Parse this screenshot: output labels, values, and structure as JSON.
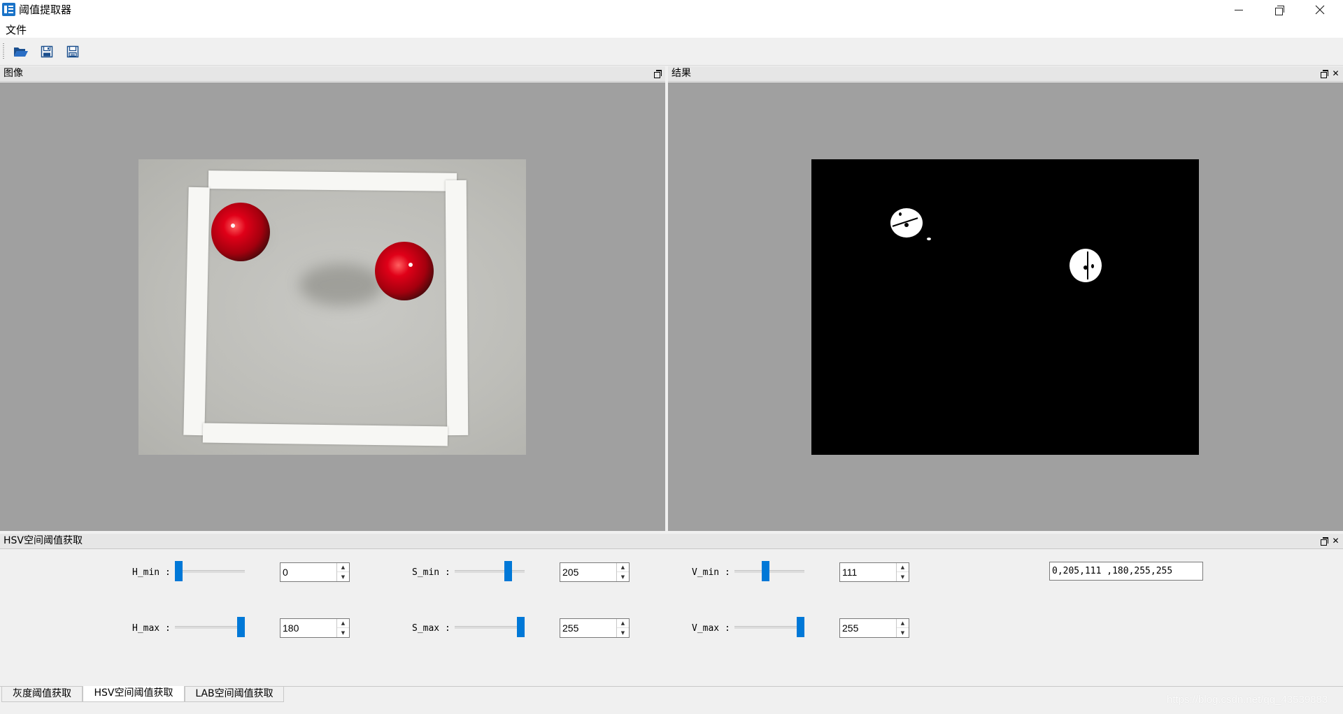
{
  "window": {
    "title": "阈值提取器",
    "controls": [
      "minimize",
      "restore",
      "close"
    ]
  },
  "menu": {
    "items": [
      "文件"
    ]
  },
  "toolbar": {
    "buttons": [
      {
        "icon": "folder-open-icon"
      },
      {
        "icon": "save-icon"
      },
      {
        "icon": "save-as-icon"
      }
    ]
  },
  "panels": {
    "image": {
      "title": "图像"
    },
    "result": {
      "title": "结果"
    },
    "hsv": {
      "title": "HSV空间阈值获取"
    }
  },
  "hsv": {
    "h_min": {
      "label": "H_min :",
      "value": "0",
      "fraction": 0.0
    },
    "h_max": {
      "label": "H_max :",
      "value": "180",
      "fraction": 1.0
    },
    "s_min": {
      "label": "S_min :",
      "value": "205",
      "fraction": 0.8
    },
    "s_max": {
      "label": "S_max :",
      "value": "255",
      "fraction": 1.0
    },
    "v_min": {
      "label": "V_min :",
      "value": "111",
      "fraction": 0.435
    },
    "v_max": {
      "label": "V_max :",
      "value": "255",
      "fraction": 1.0
    },
    "result": "0,205,111 ,180,255,255"
  },
  "tabs": [
    {
      "label": "灰度阈值获取",
      "active": false
    },
    {
      "label": "HSV空间阈值获取",
      "active": true
    },
    {
      "label": "LAB空间阈值获取",
      "active": false
    }
  ],
  "watermark": "https://blog.csdn.net/qq_43539883",
  "colors": {
    "slider_handle": "#0078d7",
    "dock_background": "#a0a0a0",
    "window_background": "#f0f0f0"
  }
}
